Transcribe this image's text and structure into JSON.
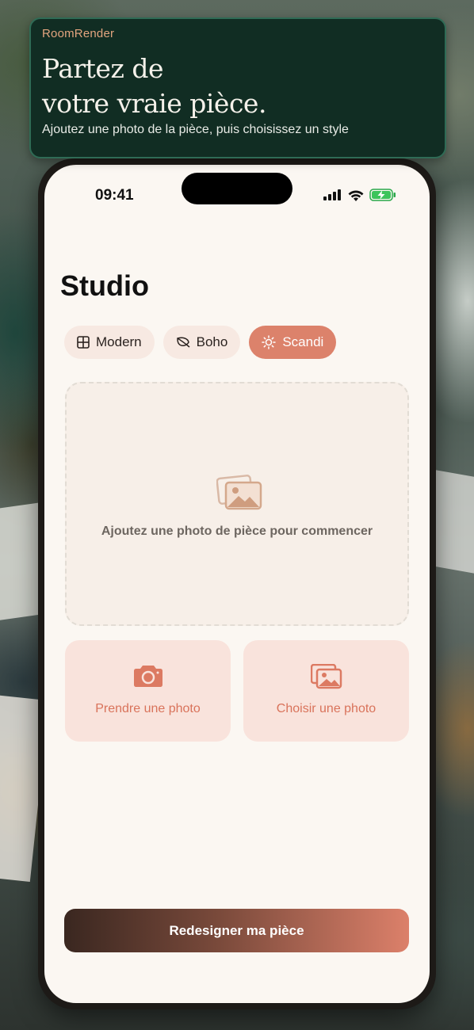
{
  "banner": {
    "brand": "RoomRender",
    "headline_line1": "Partez de",
    "headline_line2": "votre vraie pièce.",
    "subtitle": "Ajoutez une photo de la pièce, puis choisissez un style"
  },
  "status_bar": {
    "time": "09:41",
    "icons": [
      "cellular-signal-icon",
      "wifi-icon",
      "battery-charging-icon"
    ]
  },
  "screen": {
    "title": "Studio"
  },
  "styles": [
    {
      "label": "Modern",
      "icon": "grid-icon",
      "selected": false
    },
    {
      "label": "Boho",
      "icon": "leaf-icon",
      "selected": false
    },
    {
      "label": "Scandi",
      "icon": "sun-icon",
      "selected": true
    }
  ],
  "dropzone": {
    "icon": "photos-icon",
    "hint": "Ajoutez une photo de pièce pour commencer"
  },
  "actions": {
    "take_photo": {
      "label": "Prendre une photo",
      "icon": "camera-icon"
    },
    "choose_photo": {
      "label": "Choisir une photo",
      "icon": "photo-library-icon"
    }
  },
  "cta": {
    "label": "Redesigner ma pièce"
  },
  "colors": {
    "accent": "#dc826b",
    "banner_bg": "#112d23",
    "screen_bg": "#fbf7f2",
    "brand_text": "#e3a57f"
  }
}
